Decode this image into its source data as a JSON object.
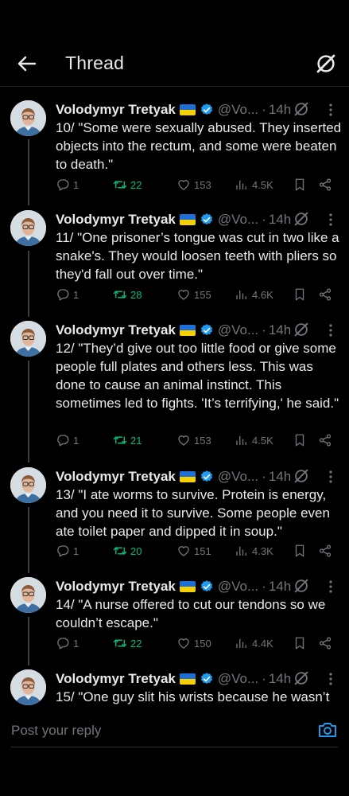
{
  "header": {
    "title": "Thread"
  },
  "colors": {
    "background": "#000000",
    "text": "#e7e9ea",
    "muted": "#71767b",
    "retweet": "#00ba7c",
    "accent": "#1d9bf0"
  },
  "tweets": [
    {
      "author": "Volodymyr Tretyak",
      "handle": "@Vo...",
      "dot": "·",
      "time": "14h",
      "text": "10/ \"Some were sexually abused. They inserted objects into the rectum, and some were beaten to death.\"",
      "replies": "1",
      "retweets": "22",
      "likes": "153",
      "views": "4.5K"
    },
    {
      "author": "Volodymyr Tretyak",
      "handle": "@Vo...",
      "dot": "·",
      "time": "14h",
      "text": "11/ \"One prisoner’s tongue was cut in two like a snake's. They would loosen teeth with pliers so they'd fall out over time.\"",
      "replies": "1",
      "retweets": "28",
      "likes": "155",
      "views": "4.6K"
    },
    {
      "author": "Volodymyr Tretyak",
      "handle": "@Vo...",
      "dot": "·",
      "time": "14h",
      "text": "12/ \"They’d give out too little food or give some people full plates and others less. This was done to cause an animal instinct. This sometimes led to fights. 'It’s terrifying,' he said.\"",
      "replies": "1",
      "retweets": "21",
      "likes": "153",
      "views": "4.5K"
    },
    {
      "author": "Volodymyr Tretyak",
      "handle": "@Vo...",
      "dot": "·",
      "time": "14h",
      "text": "13/ \"I ate worms to survive. Protein is energy, and you need it to survive. Some people even ate toilet paper and dipped it in soup.\"",
      "replies": "1",
      "retweets": "20",
      "likes": "151",
      "views": "4.3K"
    },
    {
      "author": "Volodymyr Tretyak",
      "handle": "@Vo...",
      "dot": "·",
      "time": "14h",
      "text": "14/ \"A nurse offered to cut our tendons so we couldn’t escape.\"",
      "replies": "1",
      "retweets": "22",
      "likes": "150",
      "views": "4.4K"
    },
    {
      "author": "Volodymyr Tretyak",
      "handle": "@Vo...",
      "dot": "·",
      "time": "14h",
      "text": "15/ \"One guy slit his wrists because he wasn’t",
      "replies": "",
      "retweets": "",
      "likes": "",
      "views": ""
    }
  ],
  "reply_bar": {
    "placeholder": "Post your reply"
  },
  "icons": [
    "back-arrow-icon",
    "grok-icon",
    "verified-badge-icon",
    "ukraine-flag-icon",
    "more-icon",
    "reply-icon",
    "retweet-icon",
    "like-icon",
    "views-icon",
    "bookmark-icon",
    "share-icon",
    "camera-icon"
  ]
}
